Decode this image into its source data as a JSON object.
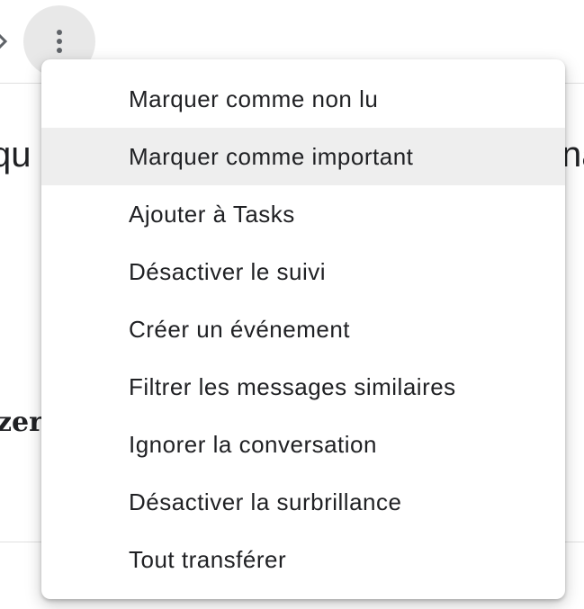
{
  "background": {
    "left_fragment": "qu",
    "right_fragment": "na",
    "bold_fragment": "zer"
  },
  "toolbar": {
    "more_icon": "more-vert-icon",
    "chevron_icon": "chevron-right-icon"
  },
  "menu": {
    "highlighted_index": 1,
    "items": [
      {
        "label": "Marquer comme non lu"
      },
      {
        "label": "Marquer comme important"
      },
      {
        "label": "Ajouter à Tasks"
      },
      {
        "label": "Désactiver le suivi"
      },
      {
        "label": "Créer un événement"
      },
      {
        "label": "Filtrer les messages similaires"
      },
      {
        "label": "Ignorer la conversation"
      },
      {
        "label": "Désactiver la surbrillance"
      },
      {
        "label": "Tout transférer"
      }
    ]
  },
  "colors": {
    "text": "#202124",
    "hover": "#eeeeee",
    "button_bg": "#e8e8e8",
    "icon": "#5f6368"
  }
}
